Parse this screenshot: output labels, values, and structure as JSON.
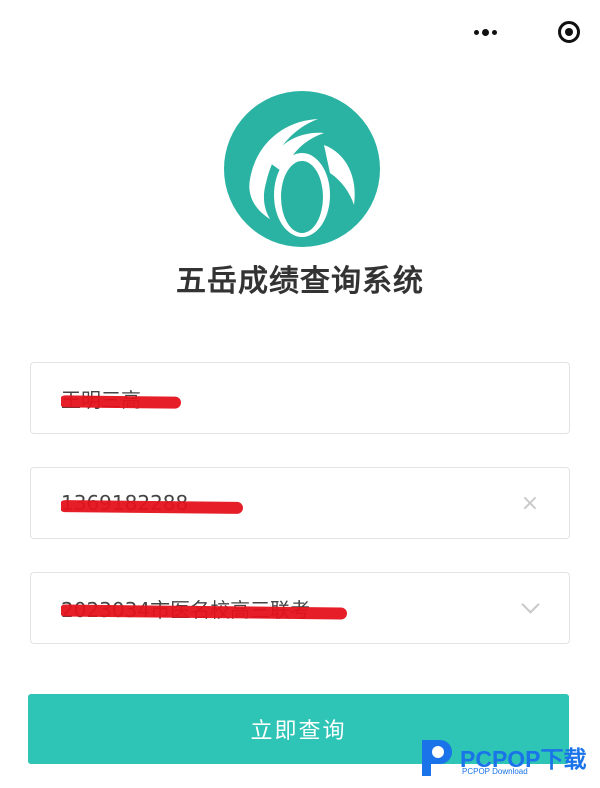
{
  "top_bar": {
    "more_icon": "more-dots-icon",
    "close_icon": "close-circle-icon"
  },
  "logo": {
    "name": "app-logo",
    "color": "#2ab3a3"
  },
  "title": "五岳成绩查询系统",
  "form": {
    "name_field": {
      "value": "王明三高"
    },
    "id_field": {
      "value": "1369182288",
      "clear_icon": "×"
    },
    "school_field": {
      "value": "2023034市医名校高三联考"
    }
  },
  "submit_label": "立即查询",
  "colors": {
    "accent": "#2ec4b6",
    "redaction": "#e4121b",
    "watermark": "#1a73e8"
  },
  "watermark": {
    "brand": "PCPOP下载",
    "sub": "PCPOP Download"
  }
}
